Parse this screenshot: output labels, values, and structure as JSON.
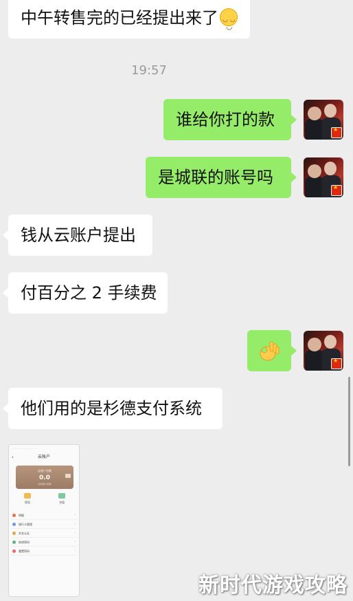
{
  "messages": [
    {
      "text": "中午转售完的已经提出来了",
      "emoji": "smiling-face"
    },
    {
      "time": "19:57"
    },
    {
      "text": "谁给你打的款"
    },
    {
      "text": "是城联的账号吗"
    },
    {
      "text": "钱从云账户提出"
    },
    {
      "text": "付百分之 2 手续费"
    },
    {
      "emoji": "ok-hand"
    },
    {
      "text": "他们用的是杉德支付系统"
    }
  ],
  "screenshot": {
    "title": "云账户",
    "card_label": "云账户总额",
    "balance": "0.0",
    "card_sub": "(仅供账户查看)",
    "action_withdraw": "提现",
    "action_topup": "充值",
    "menu": [
      "明细",
      "银行卡管理",
      "实名认证",
      "修改密码",
      "重置密码"
    ]
  },
  "watermark": "新时代游戏攻略",
  "colors": {
    "bg": "#ededed",
    "outgoing": "#95ec69",
    "incoming": "#ffffff"
  }
}
